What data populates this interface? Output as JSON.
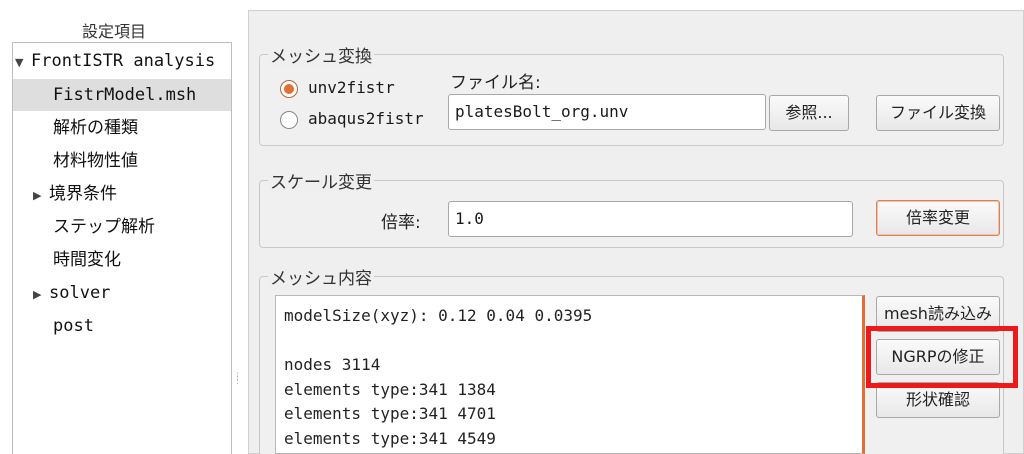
{
  "sidebar": {
    "title": "設定項目",
    "items": [
      {
        "label": "FrontISTR analysis",
        "arrow": "▼"
      },
      {
        "label": "FistrModel.msh",
        "arrow": ""
      },
      {
        "label": "解析の種類",
        "arrow": ""
      },
      {
        "label": "材料物性値",
        "arrow": ""
      },
      {
        "label": "境界条件",
        "arrow": "▶"
      },
      {
        "label": "ステップ解析",
        "arrow": ""
      },
      {
        "label": "時間変化",
        "arrow": ""
      },
      {
        "label": "solver",
        "arrow": "▶"
      },
      {
        "label": "post",
        "arrow": ""
      }
    ]
  },
  "mesh_convert": {
    "group_title": "メッシュ変換",
    "radio_unv": "unv2fistr",
    "radio_abaqus": "abaqus2fistr",
    "selected": "unv2fistr",
    "file_label": "ファイル名:",
    "file_value": "platesBolt_org.unv",
    "browse_label": "参照...",
    "convert_label": "ファイル変換"
  },
  "scale_change": {
    "group_title": "スケール変更",
    "scale_label": "倍率:",
    "scale_value": "1.0",
    "apply_label": "倍率変更"
  },
  "mesh_content": {
    "group_title": "メッシュ内容",
    "lines": [
      "modelSize(xyz): 0.12 0.04 0.0395",
      "",
      "nodes 3114",
      "elements type:341 1384",
      "elements type:341 4701",
      "elements type:341 4549"
    ],
    "load_mesh_label": "mesh読み込み",
    "fix_ngrp_label": "NGRPの修正",
    "check_shape_label": "形状確認"
  },
  "colors": {
    "accent": "#e07038",
    "highlight": "#ee1a1a"
  }
}
